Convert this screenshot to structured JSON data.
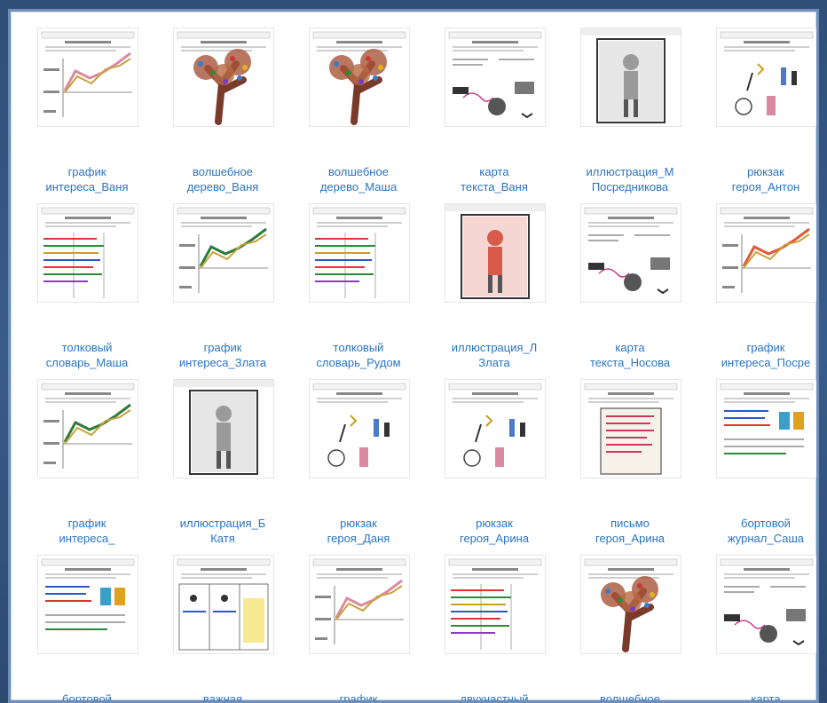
{
  "gallery": {
    "items": [
      {
        "l1": "график",
        "l2": "интереса_Ваня",
        "kind": "graph"
      },
      {
        "l1": "волшебное",
        "l2": "дерево_Ваня",
        "kind": "tree"
      },
      {
        "l1": "волшебное",
        "l2": "дерево_Маша",
        "kind": "tree"
      },
      {
        "l1": "карта",
        "l2": "текста_Ваня",
        "kind": "map"
      },
      {
        "l1": "иллюстрация_М",
        "l2": "Посредникова",
        "kind": "illustration"
      },
      {
        "l1": "рюкзак",
        "l2": "героя_Антон",
        "kind": "backpack"
      },
      {
        "l1": "толковый",
        "l2": "словарь_Маша",
        "kind": "dictionary"
      },
      {
        "l1": "график",
        "l2": "интереса_Злата",
        "kind": "graph"
      },
      {
        "l1": "толковый",
        "l2": "словарь_Рудом",
        "kind": "dictionary"
      },
      {
        "l1": "иллюстрация_Л",
        "l2": "Злата",
        "kind": "illustration"
      },
      {
        "l1": "карта",
        "l2": "текста_Носова",
        "kind": "map"
      },
      {
        "l1": "график",
        "l2": "интереса_Посре",
        "kind": "graph"
      },
      {
        "l1": "график",
        "l2": "интереса_",
        "kind": "graph"
      },
      {
        "l1": "иллюстрация_Б",
        "l2": "Катя",
        "kind": "illustration"
      },
      {
        "l1": "рюкзак",
        "l2": "героя_Даня",
        "kind": "backpack"
      },
      {
        "l1": "рюкзак",
        "l2": "героя_Арина",
        "kind": "backpack"
      },
      {
        "l1": "письмо",
        "l2": "героя_Арина",
        "kind": "letter"
      },
      {
        "l1": "бортовой",
        "l2": "журнал_Саша",
        "kind": "journal"
      },
      {
        "l1": "бортовой",
        "l2": "",
        "kind": "journal"
      },
      {
        "l1": "важная",
        "l2": "",
        "kind": "table"
      },
      {
        "l1": "график",
        "l2": "",
        "kind": "graph"
      },
      {
        "l1": "двухчастный",
        "l2": "",
        "kind": "dictionary"
      },
      {
        "l1": "волшебное",
        "l2": "",
        "kind": "tree"
      },
      {
        "l1": "карта",
        "l2": "",
        "kind": "map"
      }
    ]
  }
}
